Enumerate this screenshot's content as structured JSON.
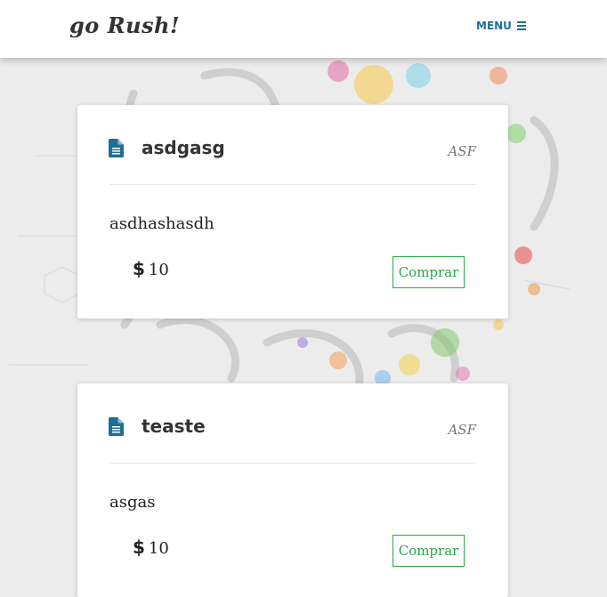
{
  "header": {
    "brand": "go Rush!",
    "menu_label": "MENU"
  },
  "products": [
    {
      "title": "asdgasg",
      "tag": "ASF",
      "description": "asdhashasdh",
      "currency_symbol": "$",
      "price": "10",
      "buy_label": "Comprar"
    },
    {
      "title": "teaste",
      "tag": "ASF",
      "description": "asgas",
      "currency_symbol": "$",
      "price": "10",
      "buy_label": "Comprar"
    }
  ],
  "colors": {
    "accent": "#1e6f93",
    "buy_button": "#28a745",
    "background": "#ececec"
  },
  "icons": {
    "menu": "bars-icon",
    "product": "document-icon",
    "currency": "dollar-icon"
  }
}
